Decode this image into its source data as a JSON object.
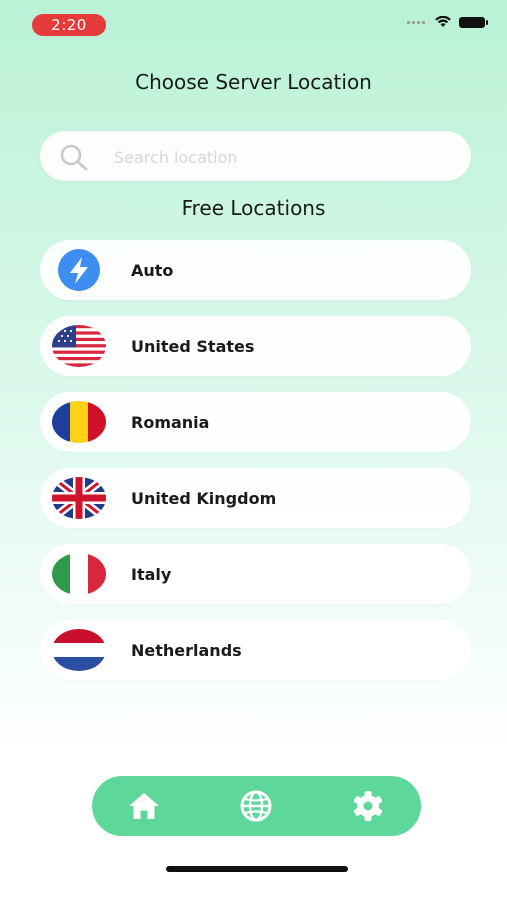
{
  "status": {
    "time": "2:20"
  },
  "header": {
    "title": "Choose Server Location"
  },
  "search": {
    "placeholder": "Search location",
    "value": ""
  },
  "section": {
    "title": "Free Locations"
  },
  "locations": [
    {
      "label": "Auto",
      "icon": "lightning-icon"
    },
    {
      "label": "United States",
      "icon": "us-flag-icon"
    },
    {
      "label": "Romania",
      "icon": "romania-flag-icon"
    },
    {
      "label": "United Kingdom",
      "icon": "uk-flag-icon"
    },
    {
      "label": "Italy",
      "icon": "italy-flag-icon"
    },
    {
      "label": "Netherlands",
      "icon": "netherlands-flag-icon"
    }
  ],
  "nav": {
    "items": [
      "home-icon",
      "globe-icon",
      "settings-gear-icon"
    ]
  },
  "colors": {
    "accent": "#5ed89a",
    "time_pill": "#e53b3b",
    "auto_icon": "#3d8ef0"
  }
}
